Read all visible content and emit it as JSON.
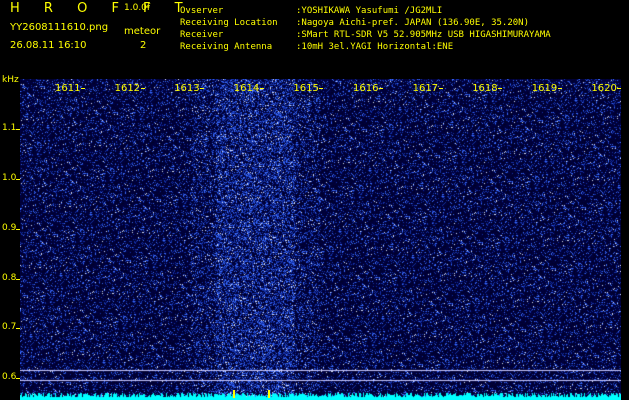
{
  "header": {
    "brand": "H R O F F T",
    "version": "1.0.0f",
    "filename": "YY2608111610.png",
    "datetime": "26.08.11 16:10",
    "meteor_label": "meteor",
    "meteor_count": "2"
  },
  "info": [
    {
      "label": "Ovserver",
      "value": "YOSHIKAWA Yasufumi /JG2MLI"
    },
    {
      "label": "Receiving Location",
      "value": "Nagoya Aichi-pref. JAPAN (136.90E, 35.20N)"
    },
    {
      "label": "Receiver",
      "value": "SMart RTL-SDR V5 52.905MHz USB HIGASHIMURAYAMA"
    },
    {
      "label": "Receiving Antenna",
      "value": "10mH 3el.YAGI Horizontal:ENE"
    }
  ],
  "spectrogram": {
    "y_unit": "kHz",
    "y_ticks": [
      "1.1",
      "1.0",
      "0.9",
      "0.8",
      "0.7",
      "0.6"
    ],
    "x_ticks": [
      "1611",
      "1612",
      "1613",
      "1614",
      "1615",
      "1616",
      "1617",
      "1618",
      "1619",
      "1620"
    ],
    "background_color": "#000033",
    "noise_color": "#3366ff",
    "axis_color": "#ffff00",
    "baseline_color": "#00ffff",
    "meteor_minute": "1614"
  }
}
